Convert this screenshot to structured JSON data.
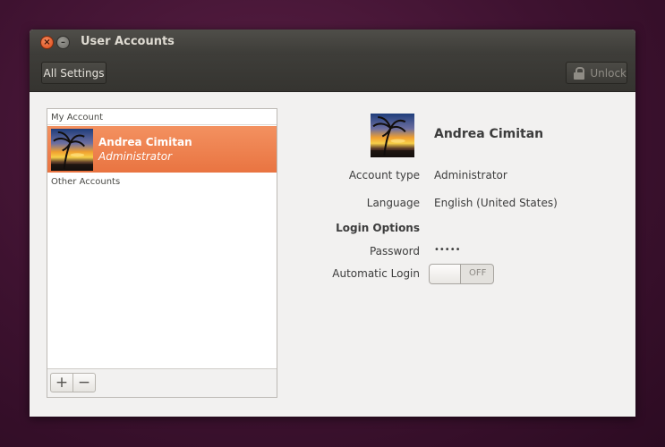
{
  "window": {
    "title": "User Accounts",
    "close_glyph": "×",
    "minimize_glyph": "–"
  },
  "toolbar": {
    "all_settings_label": "All Settings",
    "unlock_label": "Unlock",
    "unlock_icon": "lock-icon"
  },
  "account_list": {
    "my_account_header": "My Account",
    "other_accounts_header": "Other Accounts",
    "selected_account": {
      "name": "Andrea Cimitan",
      "role": "Administrator",
      "avatar_icon": "palm-tree-sunset-avatar"
    },
    "add_label": "+",
    "remove_label": "−"
  },
  "details": {
    "name": "Andrea Cimitan",
    "account_type_label": "Account type",
    "account_type_value": "Administrator",
    "language_label": "Language",
    "language_value": "English (United States)",
    "login_options_label": "Login Options",
    "password_label": "Password",
    "password_value": "•••••",
    "automatic_login_label": "Automatic Login",
    "automatic_login_state": "OFF"
  },
  "colors": {
    "selection_accent": "#ef7e4c",
    "window_bg": "#f2f1f0",
    "toolbar_bg": "#3b3a36",
    "desktop_bg": "#3e1230"
  }
}
